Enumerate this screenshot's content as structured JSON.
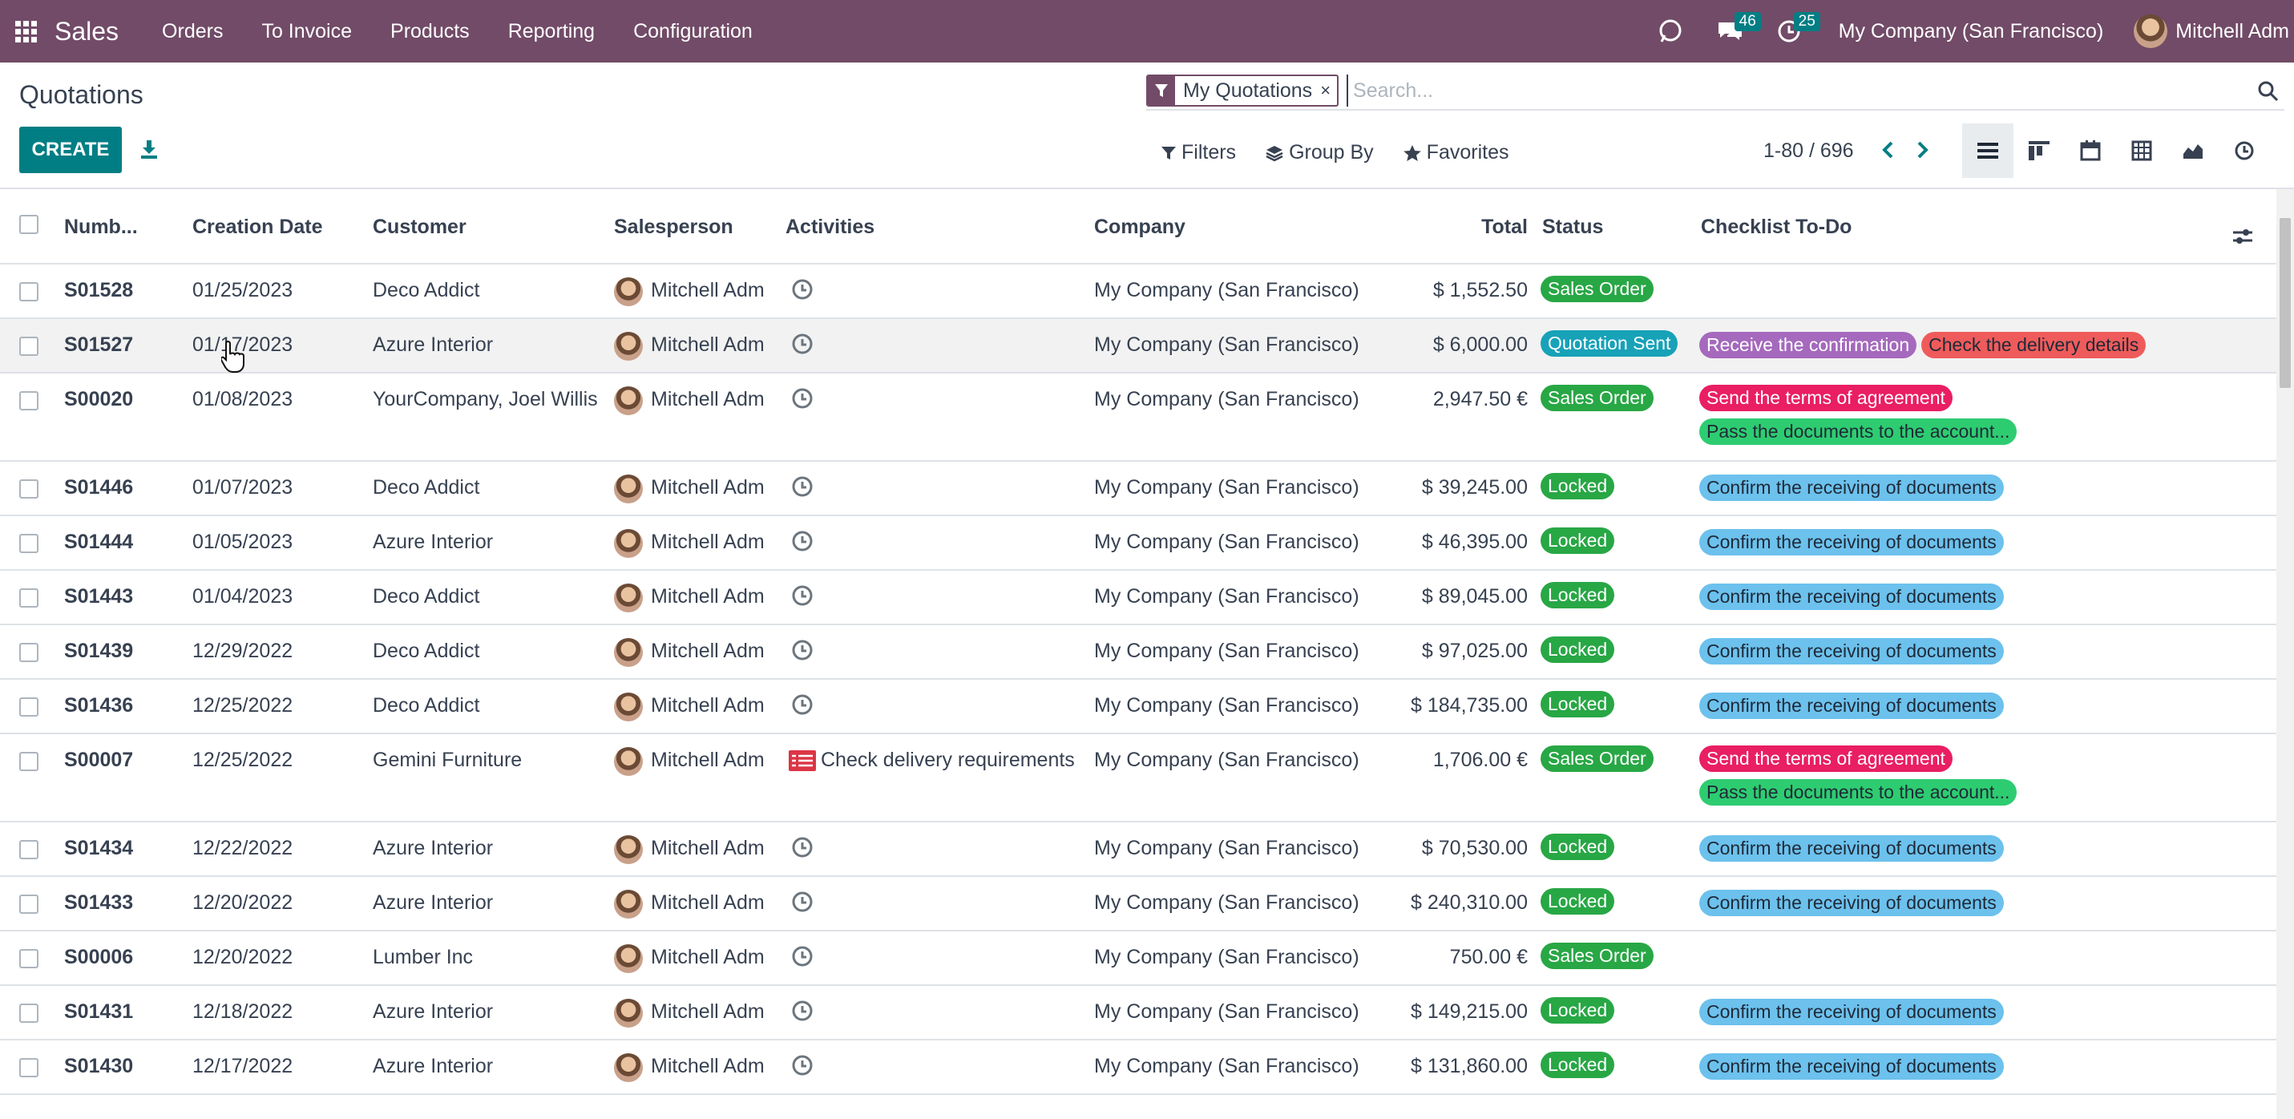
{
  "nav": {
    "brand": "Sales",
    "menus": [
      "Orders",
      "To Invoice",
      "Products",
      "Reporting",
      "Configuration"
    ],
    "messages_count": "46",
    "activities_count": "25",
    "company": "My Company (San Francisco)",
    "user": "Mitchell Adm"
  },
  "control": {
    "title": "Quotations",
    "create_label": "CREATE",
    "facet": "My Quotations",
    "facet_remove": "×",
    "search_placeholder": "Search...",
    "filters_label": "Filters",
    "groupby_label": "Group By",
    "favorites_label": "Favorites",
    "pager": "1-80 / 696"
  },
  "table": {
    "columns": [
      "Numb...",
      "Creation Date",
      "Customer",
      "Salesperson",
      "Activities",
      "Company",
      "Total",
      "Status",
      "Checklist To-Do"
    ],
    "rows": [
      {
        "number": "S01528",
        "date": "01/25/2023",
        "customer": "Deco Addict",
        "salesperson": "Mitchell Adm",
        "activity": "",
        "company": "My Company (San Francisco)",
        "total": "$ 1,552.50",
        "status": "Sales Order",
        "status_kind": "sales",
        "checklist": []
      },
      {
        "number": "S01527",
        "date": "01/17/2023",
        "customer": "Azure Interior",
        "salesperson": "Mitchell Adm",
        "activity": "",
        "company": "My Company (San Francisco)",
        "total": "$ 6,000.00",
        "status": "Quotation Sent",
        "status_kind": "sent",
        "checklist": [
          {
            "text": "Receive the confirmation",
            "kind": "purple"
          },
          {
            "text": "Check the delivery details",
            "kind": "red"
          }
        ]
      },
      {
        "number": "S00020",
        "date": "01/08/2023",
        "customer": "YourCompany, Joel Willis",
        "salesperson": "Mitchell Adm",
        "activity": "",
        "company": "My Company (San Francisco)",
        "total": "2,947.50 €",
        "status": "Sales Order",
        "status_kind": "sales",
        "checklist": [
          {
            "text": "Send the terms of agreement",
            "kind": "pink"
          },
          {
            "text": "Pass the documents to the account...",
            "kind": "green"
          }
        ]
      },
      {
        "number": "S01446",
        "date": "01/07/2023",
        "customer": "Deco Addict",
        "salesperson": "Mitchell Adm",
        "activity": "",
        "company": "My Company (San Francisco)",
        "total": "$ 39,245.00",
        "status": "Locked",
        "status_kind": "locked",
        "checklist": [
          {
            "text": "Confirm the receiving of documents",
            "kind": "blue"
          }
        ]
      },
      {
        "number": "S01444",
        "date": "01/05/2023",
        "customer": "Azure Interior",
        "salesperson": "Mitchell Adm",
        "activity": "",
        "company": "My Company (San Francisco)",
        "total": "$ 46,395.00",
        "status": "Locked",
        "status_kind": "locked",
        "checklist": [
          {
            "text": "Confirm the receiving of documents",
            "kind": "blue"
          }
        ]
      },
      {
        "number": "S01443",
        "date": "01/04/2023",
        "customer": "Deco Addict",
        "salesperson": "Mitchell Adm",
        "activity": "",
        "company": "My Company (San Francisco)",
        "total": "$ 89,045.00",
        "status": "Locked",
        "status_kind": "locked",
        "checklist": [
          {
            "text": "Confirm the receiving of documents",
            "kind": "blue"
          }
        ]
      },
      {
        "number": "S01439",
        "date": "12/29/2022",
        "customer": "Deco Addict",
        "salesperson": "Mitchell Adm",
        "activity": "",
        "company": "My Company (San Francisco)",
        "total": "$ 97,025.00",
        "status": "Locked",
        "status_kind": "locked",
        "checklist": [
          {
            "text": "Confirm the receiving of documents",
            "kind": "blue"
          }
        ]
      },
      {
        "number": "S01436",
        "date": "12/25/2022",
        "customer": "Deco Addict",
        "salesperson": "Mitchell Adm",
        "activity": "",
        "company": "My Company (San Francisco)",
        "total": "$ 184,735.00",
        "status": "Locked",
        "status_kind": "locked",
        "checklist": [
          {
            "text": "Confirm the receiving of documents",
            "kind": "blue"
          }
        ]
      },
      {
        "number": "S00007",
        "date": "12/25/2022",
        "customer": "Gemini Furniture",
        "salesperson": "Mitchell Adm",
        "activity": "Check delivery requirements",
        "company": "My Company (San Francisco)",
        "total": "1,706.00 €",
        "status": "Sales Order",
        "status_kind": "sales",
        "checklist": [
          {
            "text": "Send the terms of agreement",
            "kind": "pink"
          },
          {
            "text": "Pass the documents to the account...",
            "kind": "green"
          }
        ]
      },
      {
        "number": "S01434",
        "date": "12/22/2022",
        "customer": "Azure Interior",
        "salesperson": "Mitchell Adm",
        "activity": "",
        "company": "My Company (San Francisco)",
        "total": "$ 70,530.00",
        "status": "Locked",
        "status_kind": "locked",
        "checklist": [
          {
            "text": "Confirm the receiving of documents",
            "kind": "blue"
          }
        ]
      },
      {
        "number": "S01433",
        "date": "12/20/2022",
        "customer": "Azure Interior",
        "salesperson": "Mitchell Adm",
        "activity": "",
        "company": "My Company (San Francisco)",
        "total": "$ 240,310.00",
        "status": "Locked",
        "status_kind": "locked",
        "checklist": [
          {
            "text": "Confirm the receiving of documents",
            "kind": "blue"
          }
        ]
      },
      {
        "number": "S00006",
        "date": "12/20/2022",
        "customer": "Lumber Inc",
        "salesperson": "Mitchell Adm",
        "activity": "",
        "company": "My Company (San Francisco)",
        "total": "750.00 €",
        "status": "Sales Order",
        "status_kind": "sales",
        "checklist": []
      },
      {
        "number": "S01431",
        "date": "12/18/2022",
        "customer": "Azure Interior",
        "salesperson": "Mitchell Adm",
        "activity": "",
        "company": "My Company (San Francisco)",
        "total": "$ 149,215.00",
        "status": "Locked",
        "status_kind": "locked",
        "checklist": [
          {
            "text": "Confirm the receiving of documents",
            "kind": "blue"
          }
        ]
      },
      {
        "number": "S01430",
        "date": "12/17/2022",
        "customer": "Azure Interior",
        "salesperson": "Mitchell Adm",
        "activity": "",
        "company": "My Company (San Francisco)",
        "total": "$ 131,860.00",
        "status": "Locked",
        "status_kind": "locked",
        "checklist": [
          {
            "text": "Confirm the receiving of documents",
            "kind": "blue"
          }
        ]
      }
    ]
  }
}
